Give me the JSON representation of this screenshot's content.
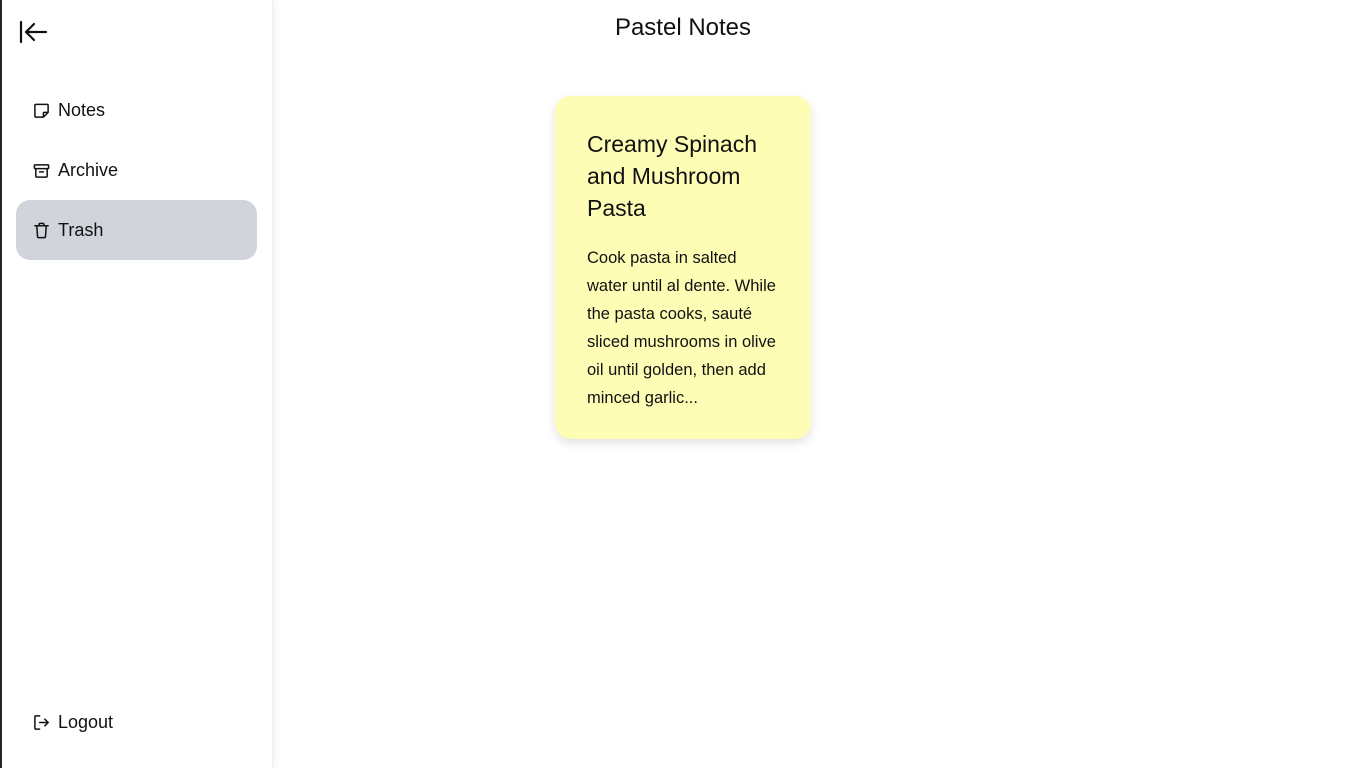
{
  "app": {
    "title": "Pastel Notes"
  },
  "sidebar": {
    "collapse_icon": "collapse-left-icon",
    "items": [
      {
        "label": "Notes",
        "icon": "note-icon",
        "active": false
      },
      {
        "label": "Archive",
        "icon": "archive-icon",
        "active": false
      },
      {
        "label": "Trash",
        "icon": "trash-icon",
        "active": true
      }
    ],
    "logout": {
      "label": "Logout",
      "icon": "logout-icon"
    }
  },
  "notes": [
    {
      "title": "Creamy Spinach and Mushroom Pasta",
      "body": "Cook pasta in salted water until al dente. While the pasta cooks, sauté sliced mushrooms in olive oil until golden, then add minced garlic...",
      "color": "#fdfdb6"
    }
  ],
  "colors": {
    "active_nav_bg": "#d1d5db",
    "note_yellow": "#fdfdb6"
  }
}
